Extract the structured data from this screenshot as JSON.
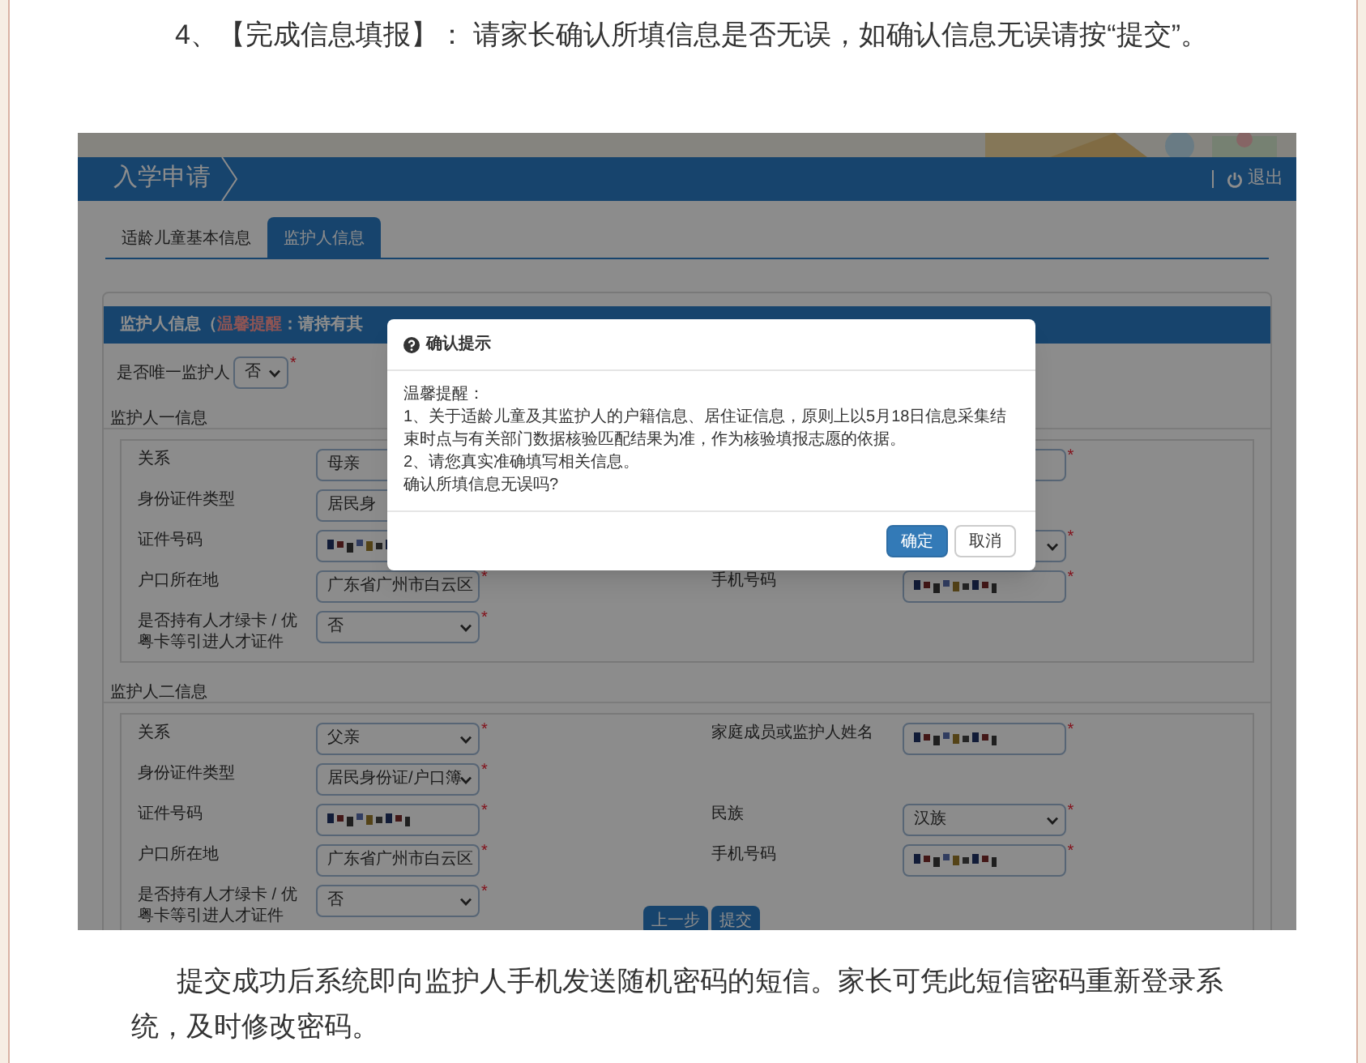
{
  "intro_paragraph": "4、【完成信息填报】： 请家长确认所填信息是否无误，如确认信息无误请按“提交”。",
  "app": {
    "title": "入学申请",
    "logout": "退出",
    "tabs": [
      {
        "label": "适龄儿童基本信息",
        "selected": false
      },
      {
        "label": "监护人信息",
        "selected": true
      }
    ],
    "panel_title": "监护人信息（",
    "panel_alert": "温馨提醒",
    "panel_note": "：请持有其",
    "only_guardian": {
      "label": "是否唯一监护人",
      "value": "否",
      "required": true
    },
    "required_mark": "*",
    "guardians": [
      {
        "legend": "监护人一信息",
        "rows": [
          {
            "left": {
              "label": "关系",
              "value": "母亲",
              "kind": "input",
              "required": false
            },
            "right": {
              "kind": "input",
              "required": true
            }
          },
          {
            "left": {
              "label": "身份证件类型",
              "value": "居民身",
              "kind": "input",
              "required": false
            }
          },
          {
            "left": {
              "label": "证件号码",
              "kind": "redacted",
              "required": false
            },
            "right": {
              "kind": "select",
              "required": true
            }
          },
          {
            "left": {
              "label": "户口所在地",
              "value": "广东省广州市白云区",
              "kind": "input",
              "required": true
            },
            "right": {
              "label": "手机号码",
              "kind": "redacted",
              "required": true
            }
          },
          {
            "left": {
              "label": "是否持有人才绿卡 / 优粤卡等引进人才证件",
              "value": "否",
              "kind": "select",
              "required": true
            }
          }
        ]
      },
      {
        "legend": "监护人二信息",
        "rows": [
          {
            "left": {
              "label": "关系",
              "value": "父亲",
              "kind": "select",
              "required": true
            },
            "right": {
              "label": "家庭成员或监护人姓名",
              "kind": "redacted",
              "required": true
            }
          },
          {
            "left": {
              "label": "身份证件类型",
              "value": "居民身份证/户口簿",
              "kind": "select",
              "required": true
            }
          },
          {
            "left": {
              "label": "证件号码",
              "kind": "redacted",
              "required": true
            },
            "right": {
              "label": "民族",
              "value": "汉族",
              "kind": "select",
              "required": true
            }
          },
          {
            "left": {
              "label": "户口所在地",
              "value": "广东省广州市白云区",
              "kind": "input",
              "required": true
            },
            "right": {
              "label": "手机号码",
              "kind": "redacted",
              "required": true
            }
          },
          {
            "left": {
              "label": "是否持有人才绿卡 / 优粤卡等引进人才证件",
              "value": "否",
              "kind": "select",
              "required": true
            }
          }
        ]
      }
    ],
    "nav_buttons": [
      "上一步",
      "提交"
    ],
    "modal": {
      "title": "确认提示",
      "lines": [
        "温馨提醒：",
        "1、关于适龄儿童及其监护人的户籍信息、居住证信息，原则上以5月18日信息采集结束时点与有关部门数据核验匹配结果为准，作为核验填报志愿的依据。",
        "2、请您真实准确填写相关信息。",
        "确认所填信息无误吗?"
      ],
      "buttons": [
        {
          "label": "确定",
          "kind": "primary"
        },
        {
          "label": "取消",
          "kind": "default"
        }
      ]
    }
  },
  "outro_paragraph": "提交成功后系统即向监护人手机发送随机密码的短信。家长可凭此短信密码重新登录系统，及时修改密码。"
}
